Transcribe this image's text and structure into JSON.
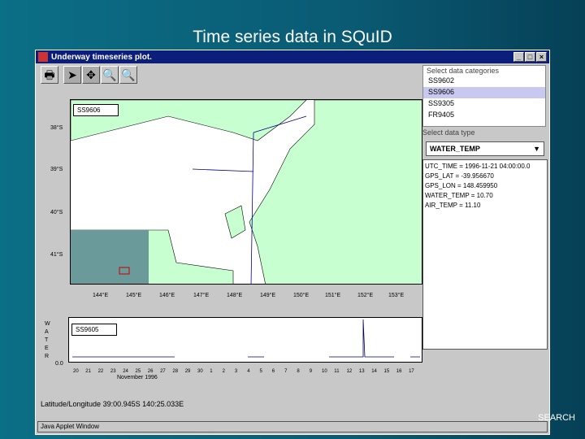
{
  "slide_title": "Time series data in SQuID",
  "window": {
    "title": "Underway timeseries plot.",
    "buttons": [
      "_",
      "□",
      "×"
    ]
  },
  "toolbar": [
    "print",
    "select",
    "pan",
    "zoom-in",
    "zoom-out"
  ],
  "map": {
    "legend": "SS9606",
    "y_labels": [
      "38°S",
      "39°S",
      "40°S",
      "41°S"
    ],
    "x_labels": [
      "144°E",
      "145°E",
      "146°E",
      "147°E",
      "148°E",
      "149°E",
      "150°E",
      "151°E",
      "152°E",
      "153°E"
    ]
  },
  "timeseries": {
    "legend": "SS9605",
    "y_axis_label": "WATER",
    "y_zero": "0.0",
    "x_ticks": [
      "20",
      "21",
      "22",
      "23",
      "24",
      "25",
      "26",
      "27",
      "28",
      "29",
      "30",
      "1",
      "2",
      "3",
      "4",
      "5",
      "6",
      "7",
      "8",
      "9",
      "10",
      "11",
      "12",
      "13",
      "14",
      "15",
      "16",
      "17"
    ],
    "x_label": "November 1996"
  },
  "panel": {
    "categories_header": "Select data categories",
    "categories": [
      "SS9602",
      "SS9606",
      "SS9305",
      "FR9405"
    ],
    "selected": "SS9606",
    "type_header": "Select data type",
    "type_value": "WATER_TEMP",
    "info": [
      "UTC_TIME = 1996-11-21 04:00:00.0",
      "GPS_LAT = -39.956670",
      "GPS_LON = 148.459950",
      "WATER_TEMP = 10.70",
      "AIR_TEMP = 11.10"
    ]
  },
  "coord_readout": "Latitude/Longitude 39:00.945S 140:25.033E",
  "status": "Java Applet Window",
  "logo_text": "SEARCH"
}
